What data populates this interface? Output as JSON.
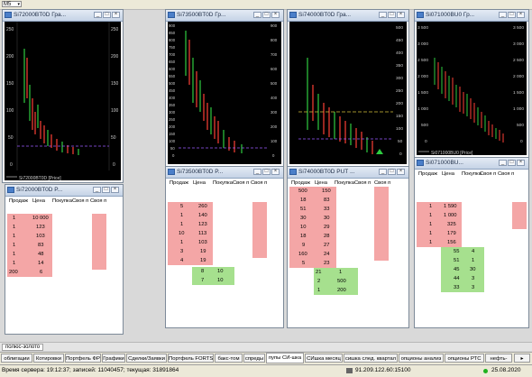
{
  "timeframe": "M5",
  "windows": {
    "c1": {
      "title": "Si72000BT0D Гра...",
      "legend": "Si72000BT0D [Price]",
      "ylabels": [
        "250",
        "200",
        "150",
        "100",
        "50",
        "0"
      ],
      "color_line": "#9b59ff"
    },
    "c2": {
      "title": "Si73500BT0D Гр...",
      "ylabels": [
        "900",
        "850",
        "800",
        "750",
        "700",
        "650",
        "600",
        "550",
        "500",
        "450",
        "400",
        "350",
        "300",
        "250",
        "200",
        "150",
        "100",
        "50",
        "0"
      ]
    },
    "c3": {
      "title": "Si74000BT0D Гра...",
      "ylabels": [
        "500",
        "450",
        "400",
        "350",
        "300",
        "250",
        "200",
        "150",
        "100",
        "50",
        "0"
      ]
    },
    "c4": {
      "title": "Si071000BU0 Гр...",
      "legend": "Si071000BU0 [Price]",
      "ylabels": [
        "3 500",
        "3 000",
        "2 500",
        "2 000",
        "1 500",
        "1 000",
        "500",
        "0"
      ]
    }
  },
  "glasses": {
    "g1": {
      "title": "Si72000BT0D P...",
      "headers": [
        "Продаж",
        "Цена",
        "Покупка",
        "Своя п",
        "Своя п"
      ],
      "sell": [
        [
          "1",
          "10 000"
        ],
        [
          "1",
          "123"
        ],
        [
          "1",
          "103"
        ],
        [
          "1",
          "83"
        ],
        [
          "1",
          "48"
        ],
        [
          "1",
          "14"
        ],
        [
          "200",
          "6"
        ]
      ],
      "buy": []
    },
    "g2": {
      "title": "Si73500BT0D P...",
      "headers": [
        "Продаж",
        "Цена",
        "Покупка",
        "Своя п",
        "Своя п"
      ],
      "sell": [
        [
          "5",
          "260"
        ],
        [
          "1",
          "140"
        ],
        [
          "1",
          "123"
        ],
        [
          "10",
          "113"
        ],
        [
          "1",
          "103"
        ],
        [
          "3",
          "19"
        ],
        [
          "4",
          "19"
        ]
      ],
      "buy": [
        [
          "8",
          "10"
        ],
        [
          "7",
          "10"
        ]
      ]
    },
    "g3": {
      "title": "Si74000BT0D PUT ...",
      "headers": [
        "Продаж",
        "Цена",
        "Покупка",
        "Своя п",
        "Своя п"
      ],
      "sell": [
        [
          "500",
          "150"
        ],
        [
          "18",
          "83"
        ],
        [
          "51",
          "33"
        ],
        [
          "30",
          "30"
        ],
        [
          "10",
          "29"
        ],
        [
          "18",
          "28"
        ],
        [
          "9",
          "27"
        ],
        [
          "160",
          "24"
        ],
        [
          "5",
          "23"
        ]
      ],
      "buy": [
        [
          "21",
          "1"
        ],
        [
          "2",
          "500"
        ],
        [
          "1",
          "200"
        ]
      ]
    },
    "g4": {
      "title": "Si071000BU...",
      "headers": [
        "Продаж",
        "Цена",
        "Покупка",
        "Своя п",
        "Своя п"
      ],
      "sell": [
        [
          "1",
          "1 590"
        ],
        [
          "1",
          "1 000"
        ],
        [
          "1",
          "325"
        ],
        [
          "1",
          "179"
        ],
        [
          "1",
          "156"
        ]
      ],
      "buy": [
        [
          "55",
          "4"
        ],
        [
          "51",
          "1"
        ],
        [
          "45",
          "30"
        ],
        [
          "44",
          "3"
        ],
        [
          "33",
          "3"
        ]
      ]
    }
  },
  "group_tab": "полюс-золото",
  "tabs": [
    "облигации",
    "Котировки",
    "Портфель ФР",
    "Графики",
    "Сделки/Заявки",
    "Портфель FORTS",
    "бакс-том",
    "спреды",
    "пупы СИ-шка",
    "СИшка месяц",
    "сишка след. квартал",
    "опционы анализ",
    "опционы РТС",
    "нефть-"
  ],
  "active_tab": 8,
  "status": {
    "text": "Время сервера: 19:12:37; записей: 11040457; текущая: 31891864",
    "ip": "91.209.122.60:15100",
    "date": "25.08.2020"
  },
  "colors": {
    "sell": "#f4a6a6",
    "buy": "#a6e08e",
    "chart_bg": "#000000",
    "status_ok": "#1fb21f"
  }
}
